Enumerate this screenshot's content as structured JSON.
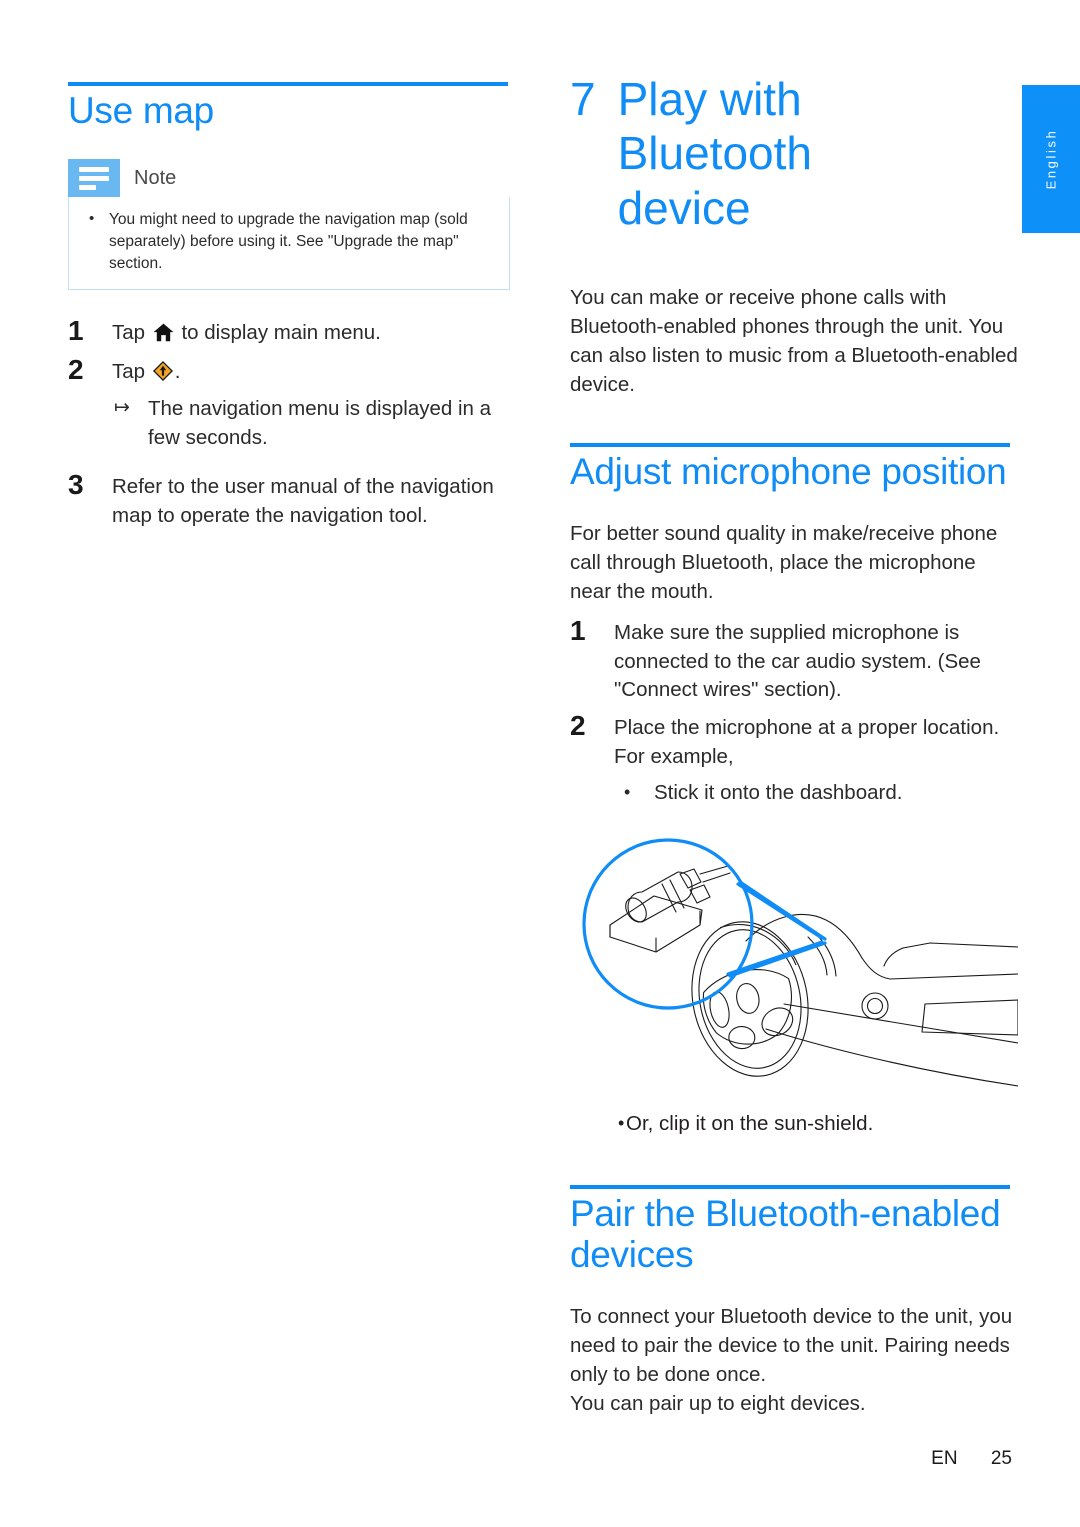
{
  "page": {
    "language_tab": "English",
    "footer_lang": "EN",
    "footer_page": "25"
  },
  "left_column": {
    "heading": "Use map",
    "note": {
      "label": "Note",
      "icon": "note-lines-icon",
      "items": [
        "You might need to upgrade the navigation map (sold separately) before using it. See \"Upgrade the map\" section."
      ]
    },
    "steps": [
      {
        "number": "1",
        "text_before_icon": "Tap",
        "icon": "home-icon",
        "text_after_icon": "to display main menu."
      },
      {
        "number": "2",
        "text_before_icon": "Tap",
        "icon": "navigation-diamond-icon",
        "text_after_icon": ".",
        "substep_arrow": "↦",
        "substep": "The navigation menu is displayed in a few seconds."
      },
      {
        "number": "3",
        "text": "Refer to the user manual of the navigation map to operate the navigation tool."
      }
    ]
  },
  "right_column": {
    "chapter": {
      "number": "7",
      "title": "Play with Bluetooth device"
    },
    "intro": "You can make or receive phone calls with Bluetooth-enabled phones through the unit. You can also listen to music from a Bluetooth-enabled device.",
    "section_mic": {
      "heading": "Adjust microphone position",
      "intro": "For better sound quality in make/receive phone call through Bluetooth, place the microphone near the mouth.",
      "steps": [
        {
          "number": "1",
          "text": "Make sure the supplied microphone is connected to the car audio system. (See \"Connect wires\" section)."
        },
        {
          "number": "2",
          "text": "Place the microphone at a proper location. For example,",
          "bullet": "Stick it onto the dashboard."
        }
      ],
      "figure": {
        "name": "microphone-on-dashboard-illustration",
        "callout": "microphone-clip-magnified",
        "subject": "steering-wheel-and-dashboard"
      },
      "figure_caption_bullet": "Or, clip it on the sun-shield."
    },
    "section_pair": {
      "heading": "Pair the Bluetooth-enabled devices",
      "paragraphs": [
        "To connect your Bluetooth device to the unit, you need to pair the device to the unit. Pairing needs only to be done once.",
        "You can pair up to eight devices."
      ]
    }
  },
  "colors": {
    "accent_blue": "#108cf6",
    "rule_blue": "#0d8bf5",
    "note_icon_blue": "#6ab8f2",
    "note_border_blue": "#bfe0f7",
    "tab_blue": "#0d90f7",
    "nav_icon_orange": "#f5a521",
    "body_text": "#2b2b2b"
  }
}
